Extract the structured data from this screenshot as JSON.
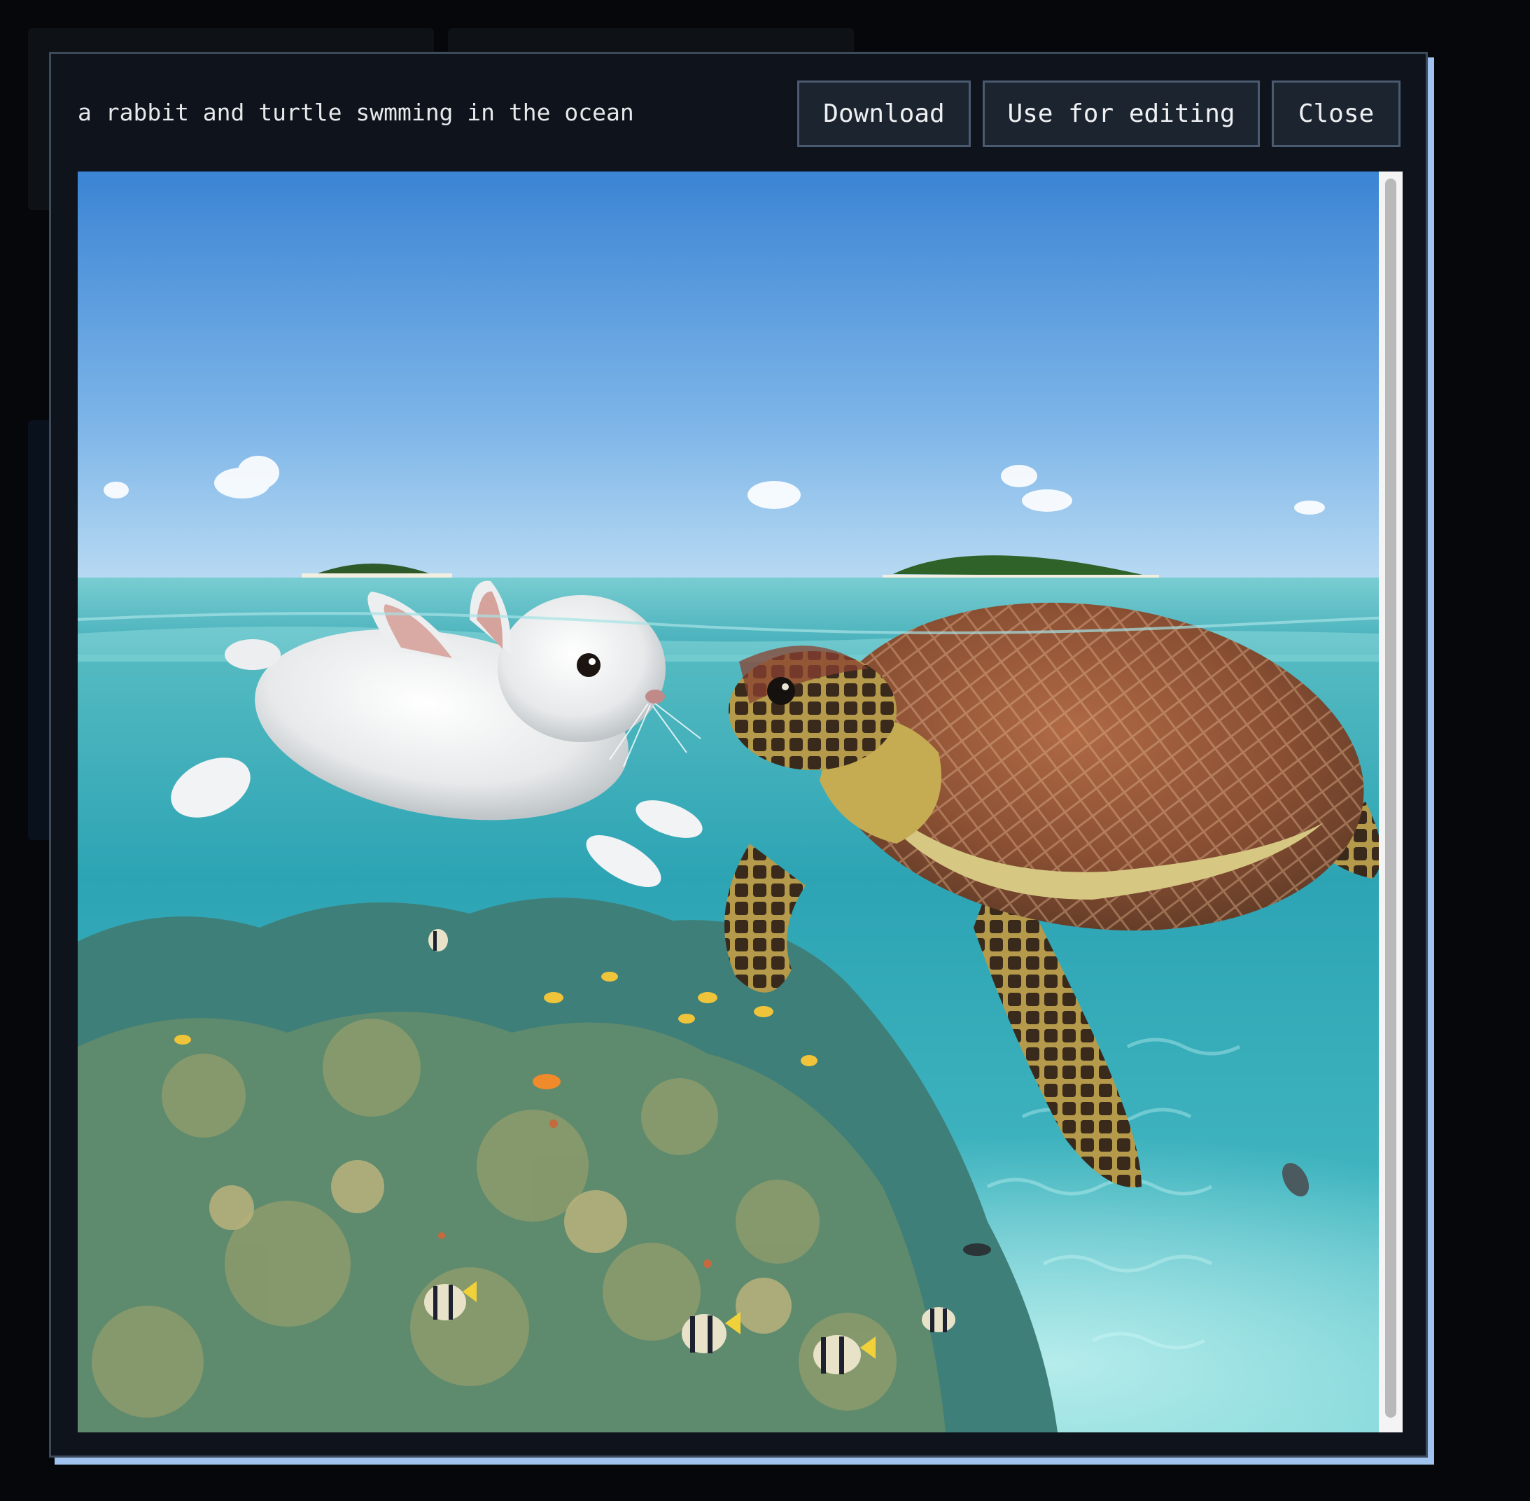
{
  "modal": {
    "prompt": "a rabbit and turtle swmming in the ocean",
    "buttons": {
      "download": "Download",
      "use_for_editing": "Use for editing",
      "close": "Close"
    }
  },
  "image": {
    "subject_icons": [
      "rabbit-figure",
      "sea-turtle-figure",
      "coral-reef",
      "island"
    ],
    "colors": {
      "sky_top": "#3d86d6",
      "sky_horizon": "#b6d8f2",
      "water_surface": "#5fc3c6",
      "water_deep": "#2aa3b3",
      "sand": "#8fe0df"
    }
  }
}
